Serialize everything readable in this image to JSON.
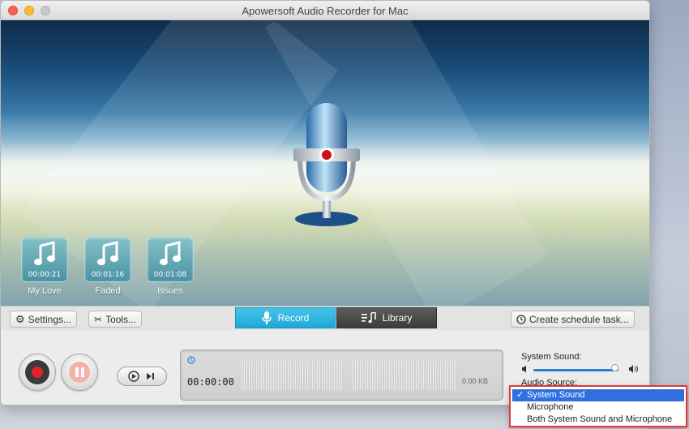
{
  "window": {
    "title": "Apowersoft Audio Recorder for Mac"
  },
  "tracks": [
    {
      "time": "00:00:21",
      "name": "My Love"
    },
    {
      "time": "00:01:16",
      "name": "Faded"
    },
    {
      "time": "00:01:08",
      "name": "Issues"
    }
  ],
  "toolbar": {
    "settings_label": "Settings...",
    "tools_label": "Tools...",
    "record_tab": "Record",
    "library_tab": "Library",
    "schedule_label": "Create schedule task..."
  },
  "recording": {
    "time": "00:00:00",
    "size": "0.00 KB"
  },
  "volume": {
    "label": "System Sound:",
    "level": 0.95
  },
  "audio_source": {
    "label": "Audio Source:",
    "check": "✓",
    "options": [
      "System Sound",
      "Microphone",
      "Both System Sound and Microphone"
    ],
    "selected": "System Sound"
  },
  "colors": {
    "accent": "#1fa8d6",
    "record_red": "#e3202c",
    "selection": "#2f6fe0",
    "highlight_border": "#e03a3a"
  }
}
